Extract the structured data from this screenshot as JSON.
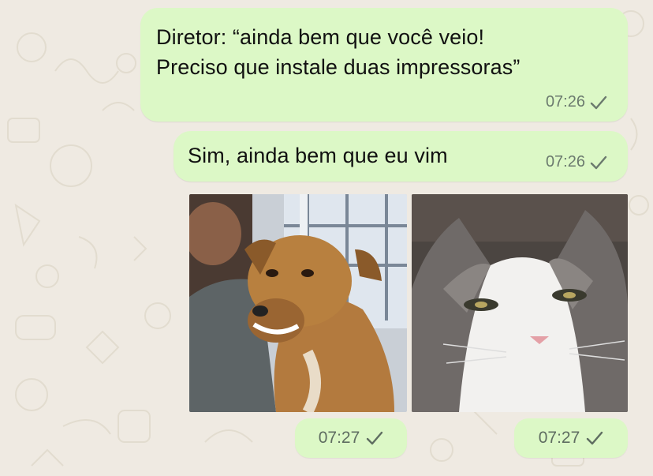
{
  "messages": [
    {
      "line1": "Diretor: “ainda bem que você veio!",
      "line2": "Preciso que instale duas impressoras”",
      "time": "07:26"
    },
    {
      "text": "Sim, ainda bem que eu vim",
      "time": "07:26"
    }
  ],
  "media": [
    {
      "icon": "dog-photo",
      "time": "07:27"
    },
    {
      "icon": "cat-photo",
      "time": "07:27"
    }
  ],
  "colors": {
    "bubble": "#dcf8c6",
    "wallpaper": "#efeae2"
  }
}
